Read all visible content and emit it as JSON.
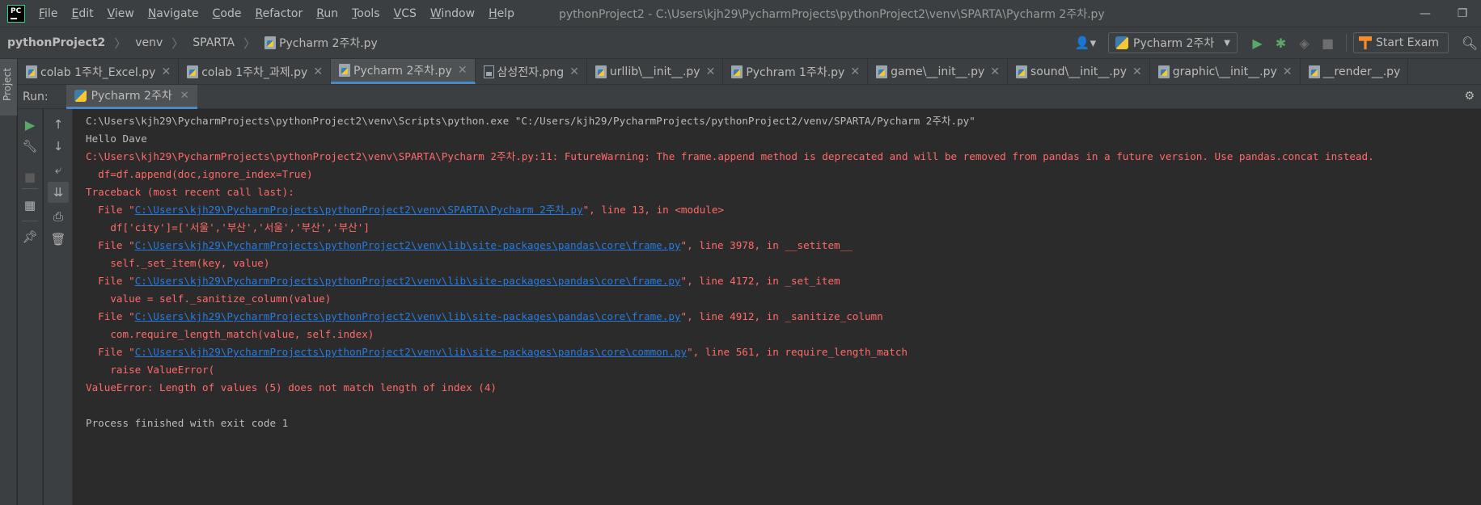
{
  "menubar": {
    "logo_text": "PC",
    "items": [
      "File",
      "Edit",
      "View",
      "Navigate",
      "Code",
      "Refactor",
      "Run",
      "Tools",
      "VCS",
      "Window",
      "Help"
    ],
    "window_title": "pythonProject2 - C:\\Users\\kjh29\\PycharmProjects\\pythonProject2\\venv\\SPARTA\\Pycharm 2주차.py"
  },
  "breadcrumbs": [
    "pythonProject2",
    "venv",
    "SPARTA",
    "Pycharm 2주차.py"
  ],
  "toolbar": {
    "run_config": "Pycharm 2주차",
    "exam_button": "Start Exam"
  },
  "sidebar": {
    "project_tab": "Project"
  },
  "tabs": [
    {
      "label": "colab 1주차_Excel.py",
      "icon": "python-file-icon",
      "active": false
    },
    {
      "label": "colab 1주차_과제.py",
      "icon": "python-file-icon",
      "active": false
    },
    {
      "label": "Pycharm 2주차.py",
      "icon": "python-file-icon",
      "active": true
    },
    {
      "label": "삼성전자.png",
      "icon": "image-file-icon",
      "active": false
    },
    {
      "label": "urllib\\__init__.py",
      "icon": "python-file-icon",
      "active": false
    },
    {
      "label": "Pychram 1주차.py",
      "icon": "python-file-icon",
      "active": false
    },
    {
      "label": "game\\__init__.py",
      "icon": "python-file-icon",
      "active": false
    },
    {
      "label": "sound\\__init__.py",
      "icon": "python-file-icon",
      "active": false
    },
    {
      "label": "graphic\\__init__.py",
      "icon": "python-file-icon",
      "active": false
    },
    {
      "label": "__render__.py",
      "icon": "python-file-icon",
      "active": false
    }
  ],
  "run_window": {
    "label": "Run:",
    "tab": "Pycharm 2주차"
  },
  "console": {
    "lines": [
      {
        "text": "C:\\Users\\kjh29\\PycharmProjects\\pythonProject2\\venv\\Scripts\\python.exe \"C:/Users/kjh29/PycharmProjects/pythonProject2/venv/SPARTA/Pycharm 2주차.py\"",
        "color": "white"
      },
      {
        "text": "Hello Dave",
        "color": "white"
      },
      {
        "text": "C:\\Users\\kjh29\\PycharmProjects\\pythonProject2\\venv\\SPARTA\\Pycharm 2주차.py:11: FutureWarning: The frame.append method is deprecated and will be removed from pandas in a future version. Use pandas.concat instead.",
        "color": "red"
      },
      {
        "text": "  df=df.append(doc,ignore_index=True)",
        "color": "red"
      },
      {
        "text": "Traceback (most recent call last):",
        "color": "red"
      },
      {
        "pre": "  File \"",
        "link": "C:\\Users\\kjh29\\PycharmProjects\\pythonProject2\\venv\\SPARTA\\Pycharm 2주차.py",
        "post": "\", line 13, in <module>",
        "color": "red"
      },
      {
        "text": "    df['city']=['서울','부산','서울','부산','부산']",
        "color": "red"
      },
      {
        "pre": "  File \"",
        "link": "C:\\Users\\kjh29\\PycharmProjects\\pythonProject2\\venv\\lib\\site-packages\\pandas\\core\\frame.py",
        "post": "\", line 3978, in __setitem__",
        "color": "red"
      },
      {
        "text": "    self._set_item(key, value)",
        "color": "red"
      },
      {
        "pre": "  File \"",
        "link": "C:\\Users\\kjh29\\PycharmProjects\\pythonProject2\\venv\\lib\\site-packages\\pandas\\core\\frame.py",
        "post": "\", line 4172, in _set_item",
        "color": "red"
      },
      {
        "text": "    value = self._sanitize_column(value)",
        "color": "red"
      },
      {
        "pre": "  File \"",
        "link": "C:\\Users\\kjh29\\PycharmProjects\\pythonProject2\\venv\\lib\\site-packages\\pandas\\core\\frame.py",
        "post": "\", line 4912, in _sanitize_column",
        "color": "red"
      },
      {
        "text": "    com.require_length_match(value, self.index)",
        "color": "red"
      },
      {
        "pre": "  File \"",
        "link": "C:\\Users\\kjh29\\PycharmProjects\\pythonProject2\\venv\\lib\\site-packages\\pandas\\core\\common.py",
        "post": "\", line 561, in require_length_match",
        "color": "red"
      },
      {
        "text": "    raise ValueError(",
        "color": "red"
      },
      {
        "text": "ValueError: Length of values (5) does not match length of index (4)",
        "color": "red"
      },
      {
        "text": "",
        "color": "white"
      },
      {
        "text": "Process finished with exit code 1",
        "color": "white"
      }
    ]
  },
  "colors": {
    "background": "#2b2b2b",
    "panel": "#3c3f41",
    "accent": "#4a88c7",
    "error_text": "#ff6b68",
    "link": "#287bde",
    "run_green": "#59a869"
  }
}
